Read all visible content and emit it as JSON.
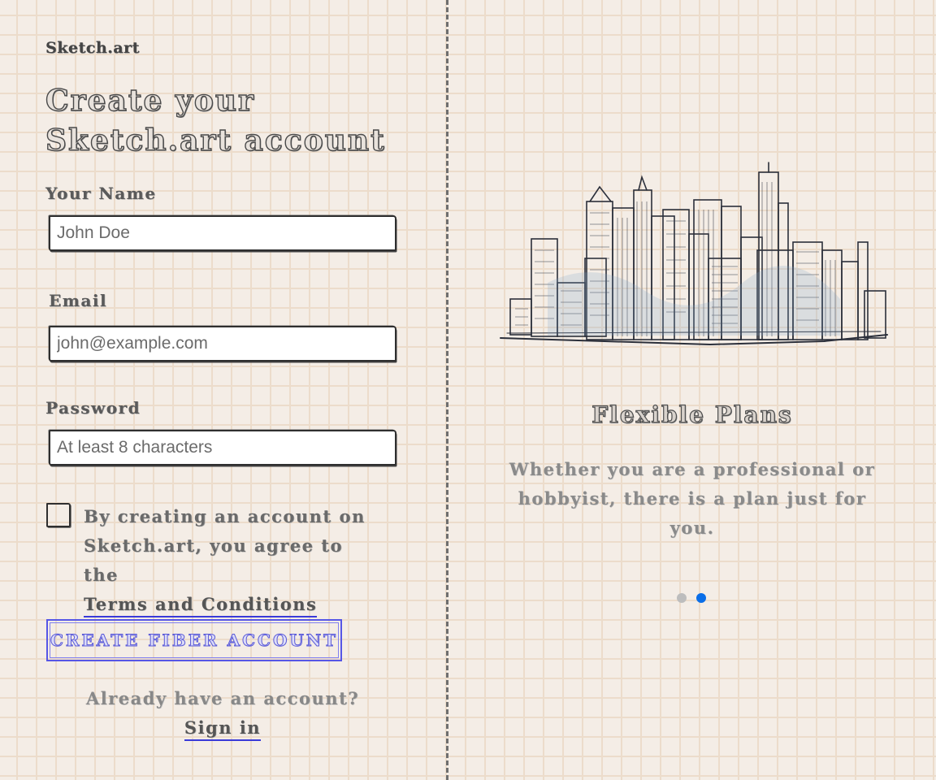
{
  "brand": "Sketch.art",
  "title": "Create your Sketch.art account",
  "form": {
    "name_label": "Your Name",
    "name_placeholder": "John Doe",
    "email_label": "Email",
    "email_placeholder": "john@example.com",
    "password_label": "Password",
    "password_placeholder": "At least 8 characters",
    "agree_text": "By creating an account on Sketch.art, you agree to the",
    "terms_link": "Terms and Conditions",
    "agree_checked": false,
    "submit_label": "CREATE FIBER ACCOUNT",
    "signin_prompt": "Already have an account?",
    "signin_link": "Sign in"
  },
  "feature": {
    "illustration": "city-skyline-sketch",
    "title": "Flexible Plans",
    "description": "Whether you are a professional or hobbyist, there is a plan just for you."
  },
  "carousel": {
    "slides": 2,
    "active_index": 1,
    "colors": {
      "active": "#0a6ee8",
      "inactive": "#bdbdbd"
    }
  },
  "colors": {
    "link_underline": "#3a3ad8",
    "button": "#5656e6",
    "grid": "#ecdccb",
    "paper": "#f4ede6"
  }
}
